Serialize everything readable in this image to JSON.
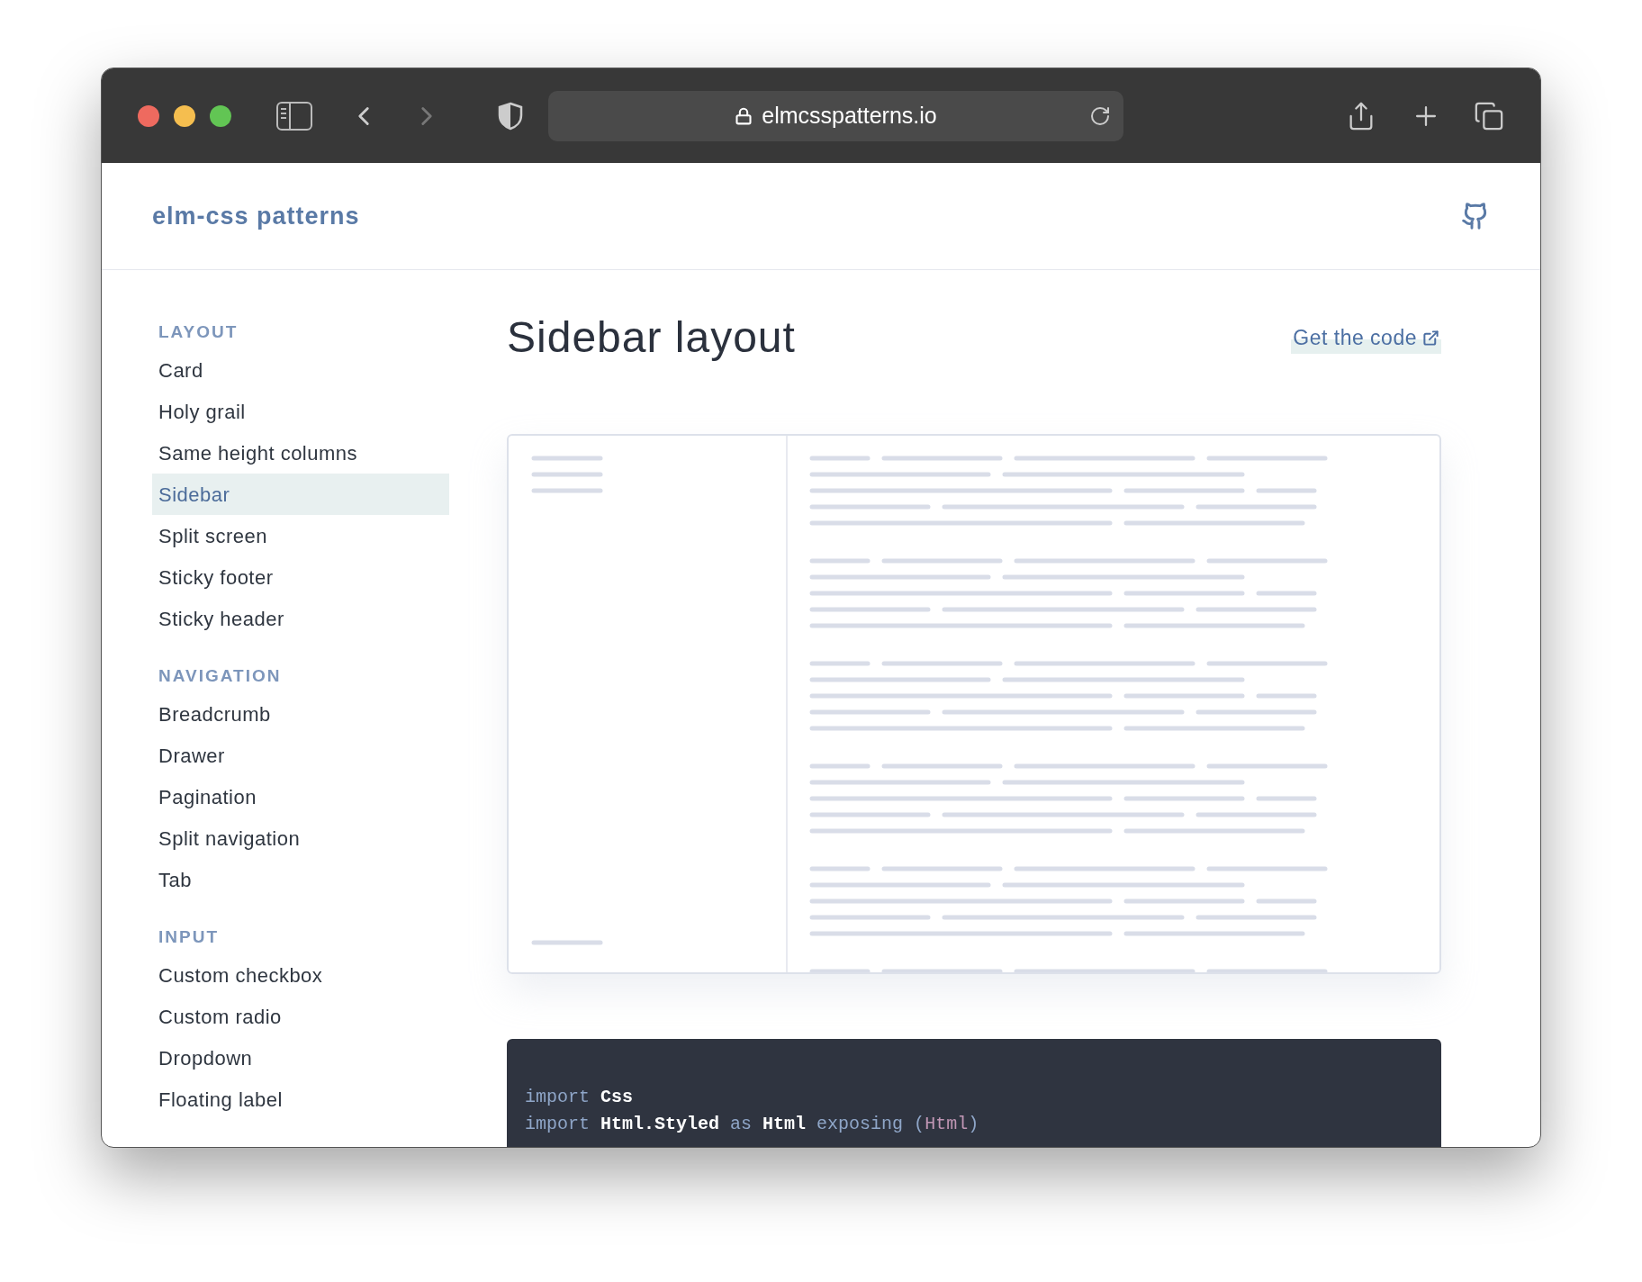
{
  "browser": {
    "url": "elmcsspatterns.io"
  },
  "header": {
    "title": "elm-css patterns"
  },
  "sidebar": {
    "sections": [
      {
        "heading": "LAYOUT",
        "items": [
          {
            "label": "Card",
            "selected": false
          },
          {
            "label": "Holy grail",
            "selected": false
          },
          {
            "label": "Same height columns",
            "selected": false
          },
          {
            "label": "Sidebar",
            "selected": true
          },
          {
            "label": "Split screen",
            "selected": false
          },
          {
            "label": "Sticky footer",
            "selected": false
          },
          {
            "label": "Sticky header",
            "selected": false
          }
        ]
      },
      {
        "heading": "NAVIGATION",
        "items": [
          {
            "label": "Breadcrumb",
            "selected": false
          },
          {
            "label": "Drawer",
            "selected": false
          },
          {
            "label": "Pagination",
            "selected": false
          },
          {
            "label": "Split navigation",
            "selected": false
          },
          {
            "label": "Tab",
            "selected": false
          }
        ]
      },
      {
        "heading": "INPUT",
        "items": [
          {
            "label": "Custom checkbox",
            "selected": false
          },
          {
            "label": "Custom radio",
            "selected": false
          },
          {
            "label": "Dropdown",
            "selected": false
          },
          {
            "label": "Floating label",
            "selected": false
          }
        ]
      }
    ]
  },
  "main": {
    "title": "Sidebar layout",
    "link": "Get the code",
    "code": [
      [
        {
          "kind": "keyword",
          "text": "import"
        },
        {
          "kind": "name",
          "text": "Css"
        }
      ],
      [
        {
          "kind": "keyword",
          "text": "import"
        },
        {
          "kind": "name",
          "text": "Html.Styled"
        },
        {
          "kind": "keyword",
          "text": "as"
        },
        {
          "kind": "name",
          "text": "Html"
        },
        {
          "kind": "keyword",
          "text": "exposing"
        },
        {
          "kind": "paren",
          "text": "("
        },
        {
          "kind": "type",
          "text": "Html"
        },
        {
          "kind": "paren",
          "text": ")"
        }
      ]
    ]
  }
}
